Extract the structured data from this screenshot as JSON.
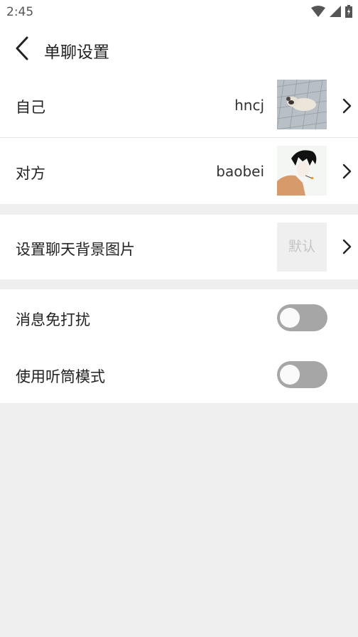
{
  "status_bar": {
    "time": "2:45"
  },
  "header": {
    "title": "单聊设置"
  },
  "rows": {
    "self": {
      "label": "自己",
      "value": "hncj"
    },
    "partner": {
      "label": "对方",
      "value": "baobei"
    },
    "background": {
      "label": "设置聊天背景图片",
      "value": "默认"
    },
    "mute": {
      "label": "消息免打扰",
      "enabled": false
    },
    "earpiece": {
      "label": "使用听筒模式",
      "enabled": false
    }
  },
  "icons": [
    "wifi-icon",
    "signal-icon",
    "battery-icon",
    "back-arrow-icon",
    "chevron-right-icon"
  ]
}
